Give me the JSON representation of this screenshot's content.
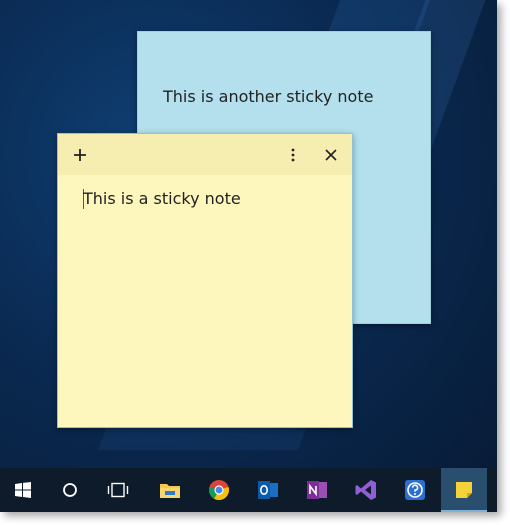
{
  "notes": {
    "back": {
      "text": "This is another sticky note"
    },
    "front": {
      "text": "This is a sticky note"
    }
  },
  "toolbar_icons": [
    "plus-icon",
    "more-icon",
    "close-icon"
  ],
  "taskbar": {
    "items": [
      {
        "name": "start-icon"
      },
      {
        "name": "search-icon"
      },
      {
        "name": "task-view-icon"
      },
      {
        "name": "file-explorer-icon"
      },
      {
        "name": "chrome-icon"
      },
      {
        "name": "outlook-icon"
      },
      {
        "name": "onenote-icon"
      },
      {
        "name": "visual-studio-icon"
      },
      {
        "name": "quick-assist-icon"
      },
      {
        "name": "sticky-notes-icon",
        "active": true
      }
    ]
  },
  "colors": {
    "note_yellow": "#fdf6bd",
    "note_yellow_header": "#f6eeb0",
    "note_blue": "#b3e0ec",
    "taskbar": "#0e1b2b",
    "desktop": "#0a2a52"
  }
}
